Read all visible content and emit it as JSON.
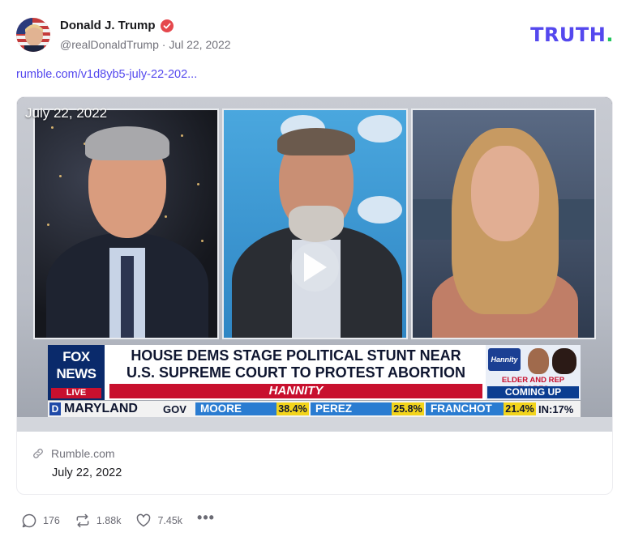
{
  "post": {
    "display_name": "Donald J. Trump",
    "handle": "@realDonaldTrump",
    "separator": "·",
    "date": "Jul 22, 2022",
    "link_text": "rumble.com/v1d8yb5-july-22-202..."
  },
  "brand": {
    "logo_main": "TRUTH",
    "logo_dot": ".",
    "colors": {
      "accent": "#5448ee",
      "dot": "#22c55e",
      "verified": "#e5484d"
    }
  },
  "video": {
    "date_overlay": "July 22, 2022",
    "chyron": {
      "network_line1": "FOX",
      "network_line2": "NEWS",
      "network_live": "LIVE",
      "headline_line1": "HOUSE DEMS STAGE POLITICAL STUNT NEAR",
      "headline_line2": "U.S. SUPREME COURT TO PROTEST ABORTION RULING",
      "show": "HANNITY",
      "promo_logo": "Hannity",
      "promo_line1": "ELDER AND REP FLORES",
      "promo_line2": "COMING UP"
    },
    "ticker": {
      "party": "D",
      "state": "MARYLAND",
      "race": "GOV",
      "candidates": [
        {
          "name": "MOORE",
          "pct": "38.4%"
        },
        {
          "name": "PEREZ",
          "pct": "25.8%"
        },
        {
          "name": "FRANCHOT",
          "pct": "21.4%"
        }
      ],
      "reporting": "IN:17%"
    }
  },
  "card": {
    "source": "Rumble.com",
    "date": "July 22, 2022"
  },
  "actions": {
    "replies": "176",
    "retruths": "1.88k",
    "likes": "7.45k",
    "more": "•••"
  }
}
